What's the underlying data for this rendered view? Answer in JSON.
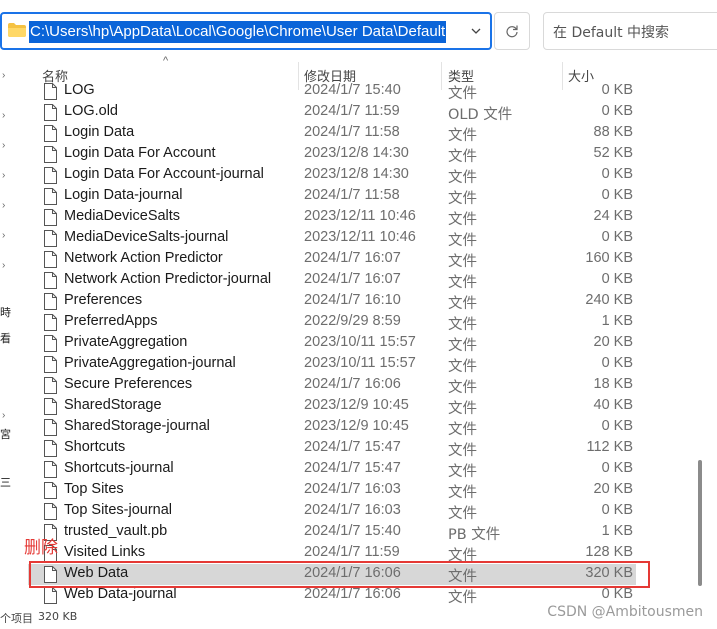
{
  "address_bar": {
    "path": "C:\\Users\\hp\\AppData\\Local\\Google\\Chrome\\User Data\\Default"
  },
  "search": {
    "placeholder": "在 Default 中搜索"
  },
  "columns": {
    "name": "名称",
    "date": "修改日期",
    "type": "类型",
    "size": "大小"
  },
  "files": [
    {
      "name": "LOG",
      "date": "2024/1/7 15:40",
      "type": "文件",
      "size": "0 KB"
    },
    {
      "name": "LOG.old",
      "date": "2024/1/7 11:59",
      "type": "OLD 文件",
      "size": "0 KB"
    },
    {
      "name": "Login Data",
      "date": "2024/1/7 11:58",
      "type": "文件",
      "size": "88 KB"
    },
    {
      "name": "Login Data For Account",
      "date": "2023/12/8 14:30",
      "type": "文件",
      "size": "52 KB"
    },
    {
      "name": "Login Data For Account-journal",
      "date": "2023/12/8 14:30",
      "type": "文件",
      "size": "0 KB"
    },
    {
      "name": "Login Data-journal",
      "date": "2024/1/7 11:58",
      "type": "文件",
      "size": "0 KB"
    },
    {
      "name": "MediaDeviceSalts",
      "date": "2023/12/11 10:46",
      "type": "文件",
      "size": "24 KB"
    },
    {
      "name": "MediaDeviceSalts-journal",
      "date": "2023/12/11 10:46",
      "type": "文件",
      "size": "0 KB"
    },
    {
      "name": "Network Action Predictor",
      "date": "2024/1/7 16:07",
      "type": "文件",
      "size": "160 KB"
    },
    {
      "name": "Network Action Predictor-journal",
      "date": "2024/1/7 16:07",
      "type": "文件",
      "size": "0 KB"
    },
    {
      "name": "Preferences",
      "date": "2024/1/7 16:10",
      "type": "文件",
      "size": "240 KB"
    },
    {
      "name": "PreferredApps",
      "date": "2022/9/29 8:59",
      "type": "文件",
      "size": "1 KB"
    },
    {
      "name": "PrivateAggregation",
      "date": "2023/10/11 15:57",
      "type": "文件",
      "size": "20 KB"
    },
    {
      "name": "PrivateAggregation-journal",
      "date": "2023/10/11 15:57",
      "type": "文件",
      "size": "0 KB"
    },
    {
      "name": "Secure Preferences",
      "date": "2024/1/7 16:06",
      "type": "文件",
      "size": "18 KB"
    },
    {
      "name": "SharedStorage",
      "date": "2023/12/9 10:45",
      "type": "文件",
      "size": "40 KB"
    },
    {
      "name": "SharedStorage-journal",
      "date": "2023/12/9 10:45",
      "type": "文件",
      "size": "0 KB"
    },
    {
      "name": "Shortcuts",
      "date": "2024/1/7 15:47",
      "type": "文件",
      "size": "112 KB"
    },
    {
      "name": "Shortcuts-journal",
      "date": "2024/1/7 15:47",
      "type": "文件",
      "size": "0 KB"
    },
    {
      "name": "Top Sites",
      "date": "2024/1/7 16:03",
      "type": "文件",
      "size": "20 KB"
    },
    {
      "name": "Top Sites-journal",
      "date": "2024/1/7 16:03",
      "type": "文件",
      "size": "0 KB"
    },
    {
      "name": "trusted_vault.pb",
      "date": "2024/1/7 15:40",
      "type": "PB 文件",
      "size": "1 KB"
    },
    {
      "name": "Visited Links",
      "date": "2024/1/7 11:59",
      "type": "文件",
      "size": "128 KB"
    },
    {
      "name": "Web Data",
      "date": "2024/1/7 16:06",
      "type": "文件",
      "size": "320 KB",
      "selected": true
    },
    {
      "name": "Web Data-journal",
      "date": "2024/1/7 16:06",
      "type": "文件",
      "size": "0 KB"
    }
  ],
  "annotation": {
    "label": "删除",
    "color": "#e53935"
  },
  "left_nav_glyphs": [
    "時",
    "看",
    "宮",
    "三"
  ],
  "status_bar": {
    "item_count": "个项目",
    "selected_size": "320 KB"
  },
  "watermark": "CSDN @Ambitousmen",
  "colors": {
    "accent": "#0a64d8",
    "selected_row": "#d7d7d7",
    "annotation": "#e53935"
  }
}
